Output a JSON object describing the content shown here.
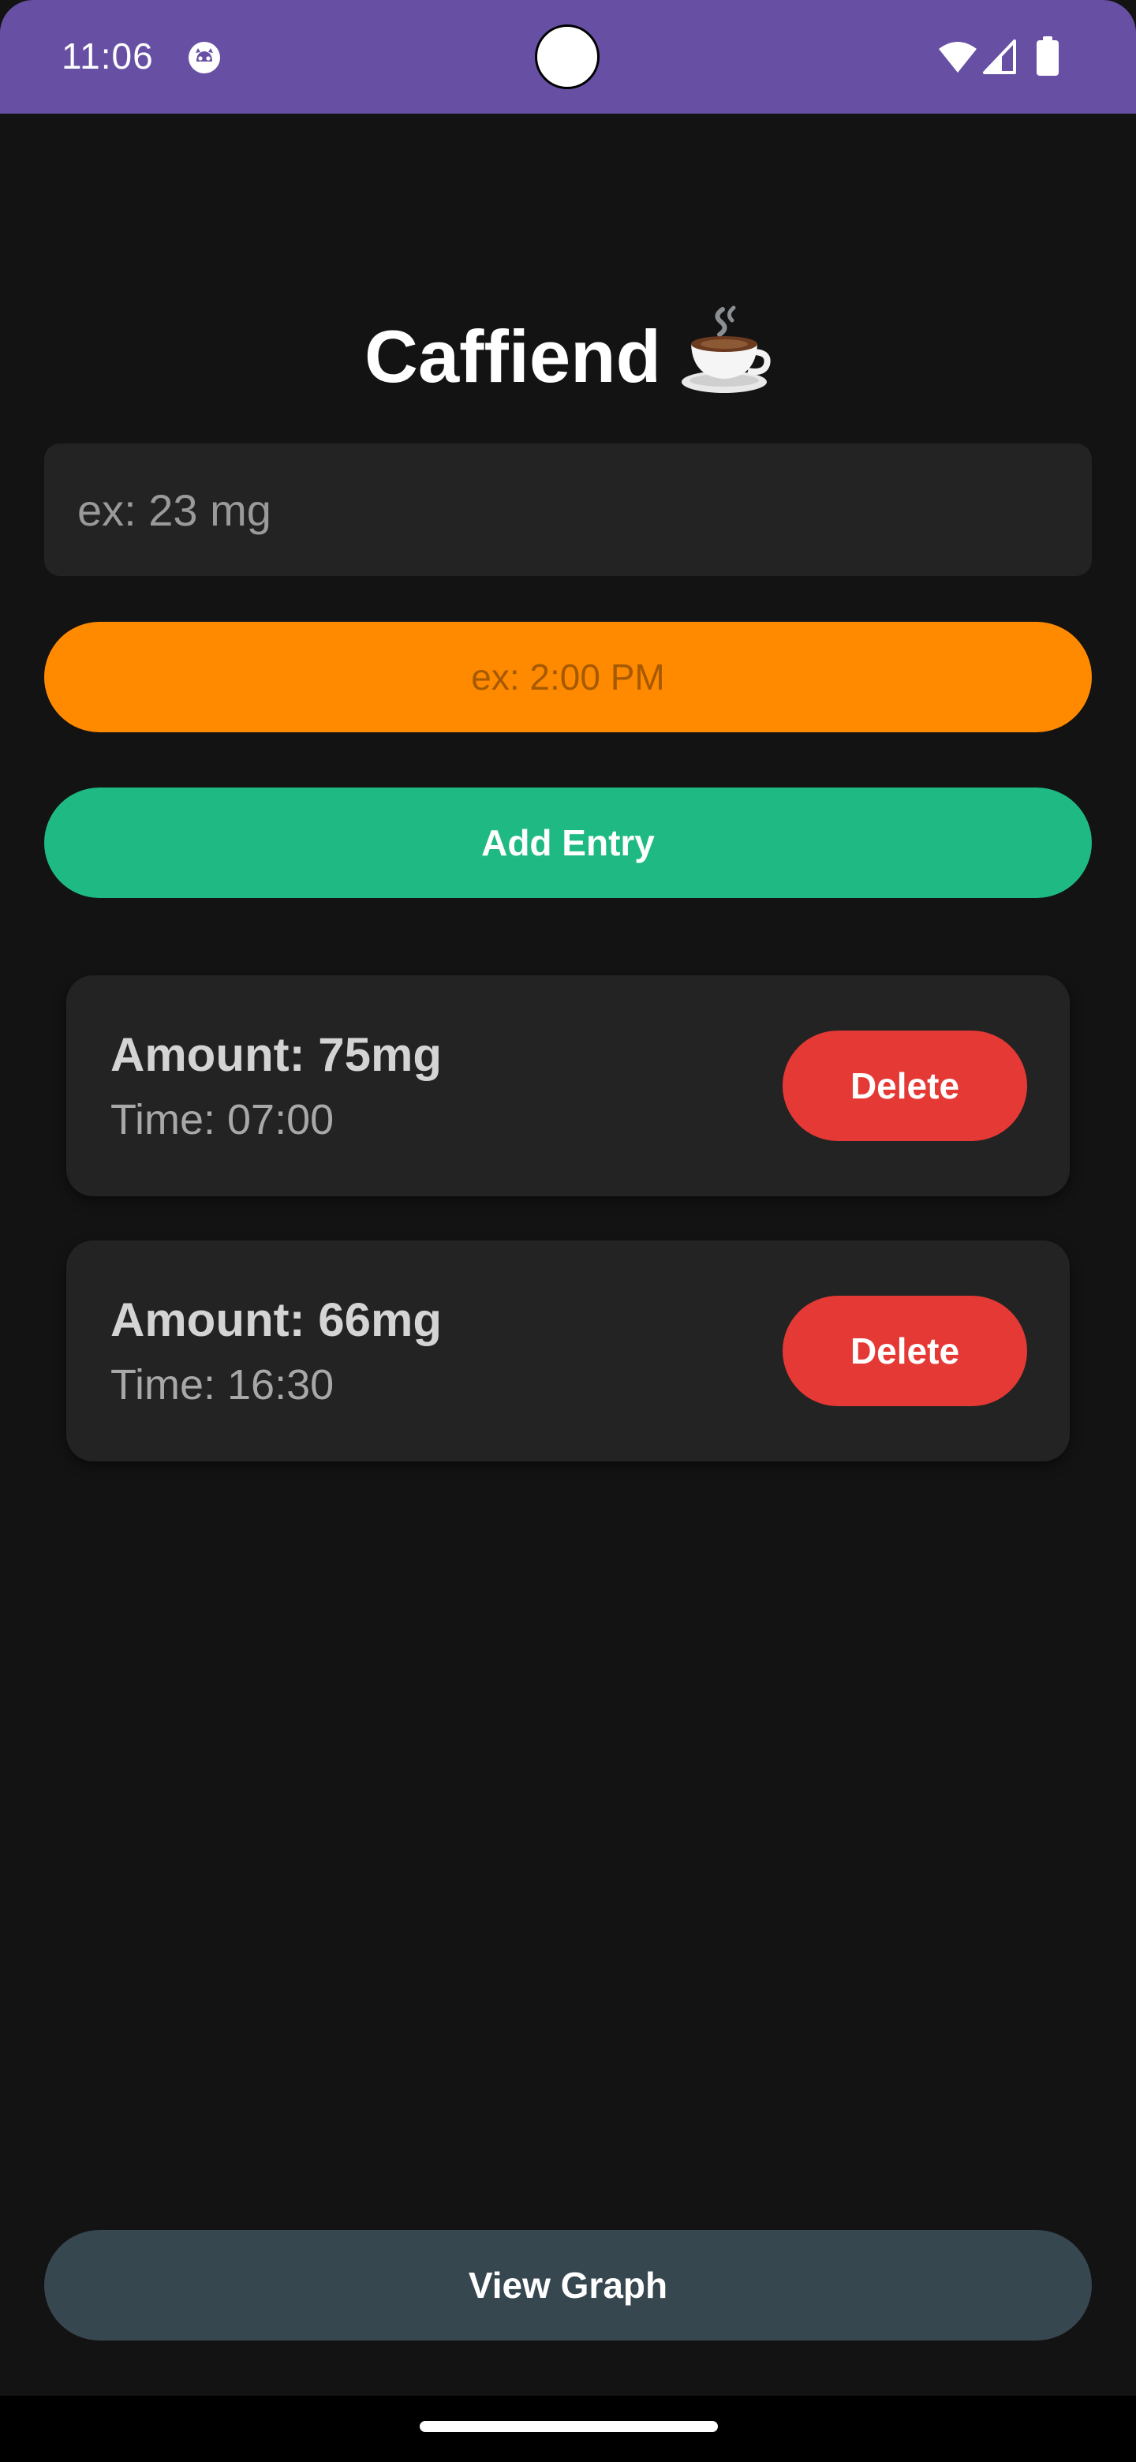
{
  "status_bar": {
    "time": "11:06",
    "background": "#6750A4",
    "icons": [
      "app-notification-icon",
      "wifi-icon",
      "signal-icon",
      "battery-icon"
    ]
  },
  "app": {
    "title": "Caffiend",
    "title_icon": "coffee-cup-icon"
  },
  "form": {
    "amount_placeholder": "ex: 23 mg",
    "amount_value": "",
    "time_placeholder": "ex: 2:00 PM",
    "add_label": "Add Entry"
  },
  "entries": [
    {
      "amount": "Amount: 75mg",
      "time": "Time: 07:00",
      "delete_label": "Delete"
    },
    {
      "amount": "Amount: 66mg",
      "time": "Time: 16:30",
      "delete_label": "Delete"
    }
  ],
  "footer": {
    "view_graph_label": "View Graph"
  },
  "colors": {
    "background": "#131313",
    "card": "#232323",
    "time_button": "#FF8A00",
    "add_button": "#1FBA83",
    "delete_button": "#E53935",
    "graph_button": "#37474F"
  }
}
